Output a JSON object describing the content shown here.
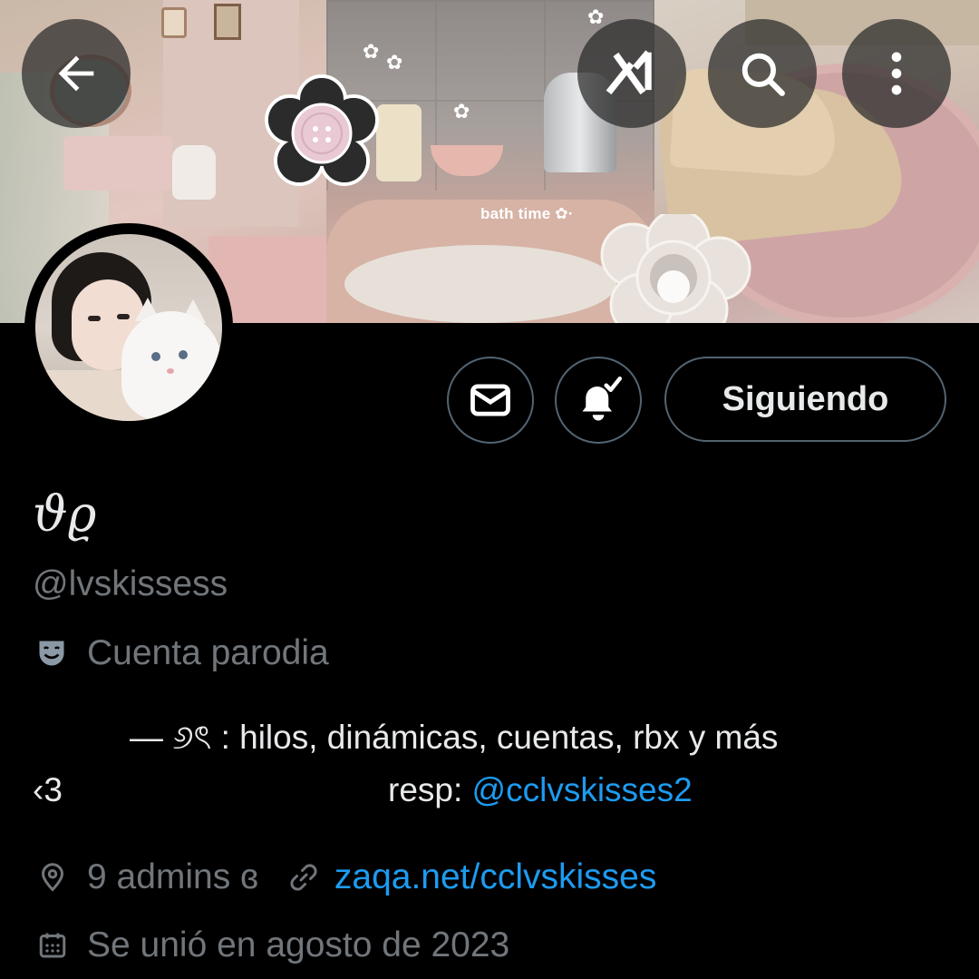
{
  "banner": {
    "sticker_text": "bath time ✿·"
  },
  "header_buttons": {
    "back_icon": "arrow-left-icon",
    "grok_icon": "grok-icon",
    "search_icon": "search-icon",
    "more_icon": "more-vertical-icon"
  },
  "actions": {
    "message_icon": "envelope-icon",
    "notify_icon": "bell-check-icon",
    "following_label": "Siguiendo"
  },
  "profile": {
    "display_name": "ϑϱ",
    "handle": "@lvskissess",
    "parody_label": "Cuenta parodia",
    "bio_line1": "— ୬ৎ : hilos, dinámicas, cuentas, rbx y más",
    "bio_line2_start": "‹3",
    "bio_resp_prefix": "resp: ",
    "bio_resp_mention": "@cclvskisses2",
    "location": "9 admins ɞ",
    "website": "zaqa.net/cclvskisses",
    "joined": "Se unió en agosto de 2023"
  },
  "colors": {
    "background": "#000000",
    "text_primary": "#e7e9ea",
    "text_secondary": "#71767b",
    "link": "#1d9bf0",
    "button_border": "#536471"
  }
}
